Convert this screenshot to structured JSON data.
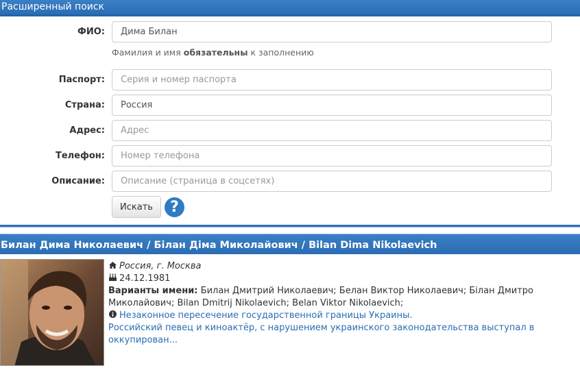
{
  "header": {
    "title": "Расширенный поиск"
  },
  "form": {
    "fio": {
      "label": "ФИО:",
      "value": "Дима Билан",
      "placeholder": ""
    },
    "fio_help": {
      "prefix": "Фамилия и имя ",
      "bold": "обязательны",
      "suffix": " к заполнению"
    },
    "passport": {
      "label": "Паспорт:",
      "value": "",
      "placeholder": "Серия и номер паспорта"
    },
    "country": {
      "label": "Страна:",
      "value": "Россия",
      "placeholder": ""
    },
    "address": {
      "label": "Адрес:",
      "value": "",
      "placeholder": "Адрес"
    },
    "phone": {
      "label": "Телефон:",
      "value": "",
      "placeholder": "Номер телефона"
    },
    "description": {
      "label": "Описание:",
      "value": "",
      "placeholder": "Описание (страница в соцсетях)"
    },
    "search_button": "Искать",
    "help_button": "?"
  },
  "result": {
    "title": "Билан Дима Николаевич / Білан Діма Миколайович / Bilan Dima Nikolaevich",
    "location": "Россия, г. Москва",
    "birthdate": "24.12.1981",
    "variants_label": "Варианты имени:",
    "variants": "Билан Дмитрий Николаевич; Белан Виктор Николаевич; Білан Дмитро Миколайович; Bilan Dmitrij Nikolaevich; Belan Viktor Nikolaevich;",
    "violation": "Незаконное пересечение государственной границы Украины.",
    "description": "Российский певец и киноактёр, с нарушением украинского законодательства выступал в оккупирован...",
    "icons": {
      "location": "home-icon",
      "birthdate": "birthday-cake-icon",
      "violation": "info-circle-icon"
    }
  },
  "colors": {
    "header_bar": "#2a6db4",
    "link": "#2a6db4",
    "help_circle": "#2f7bc4"
  }
}
